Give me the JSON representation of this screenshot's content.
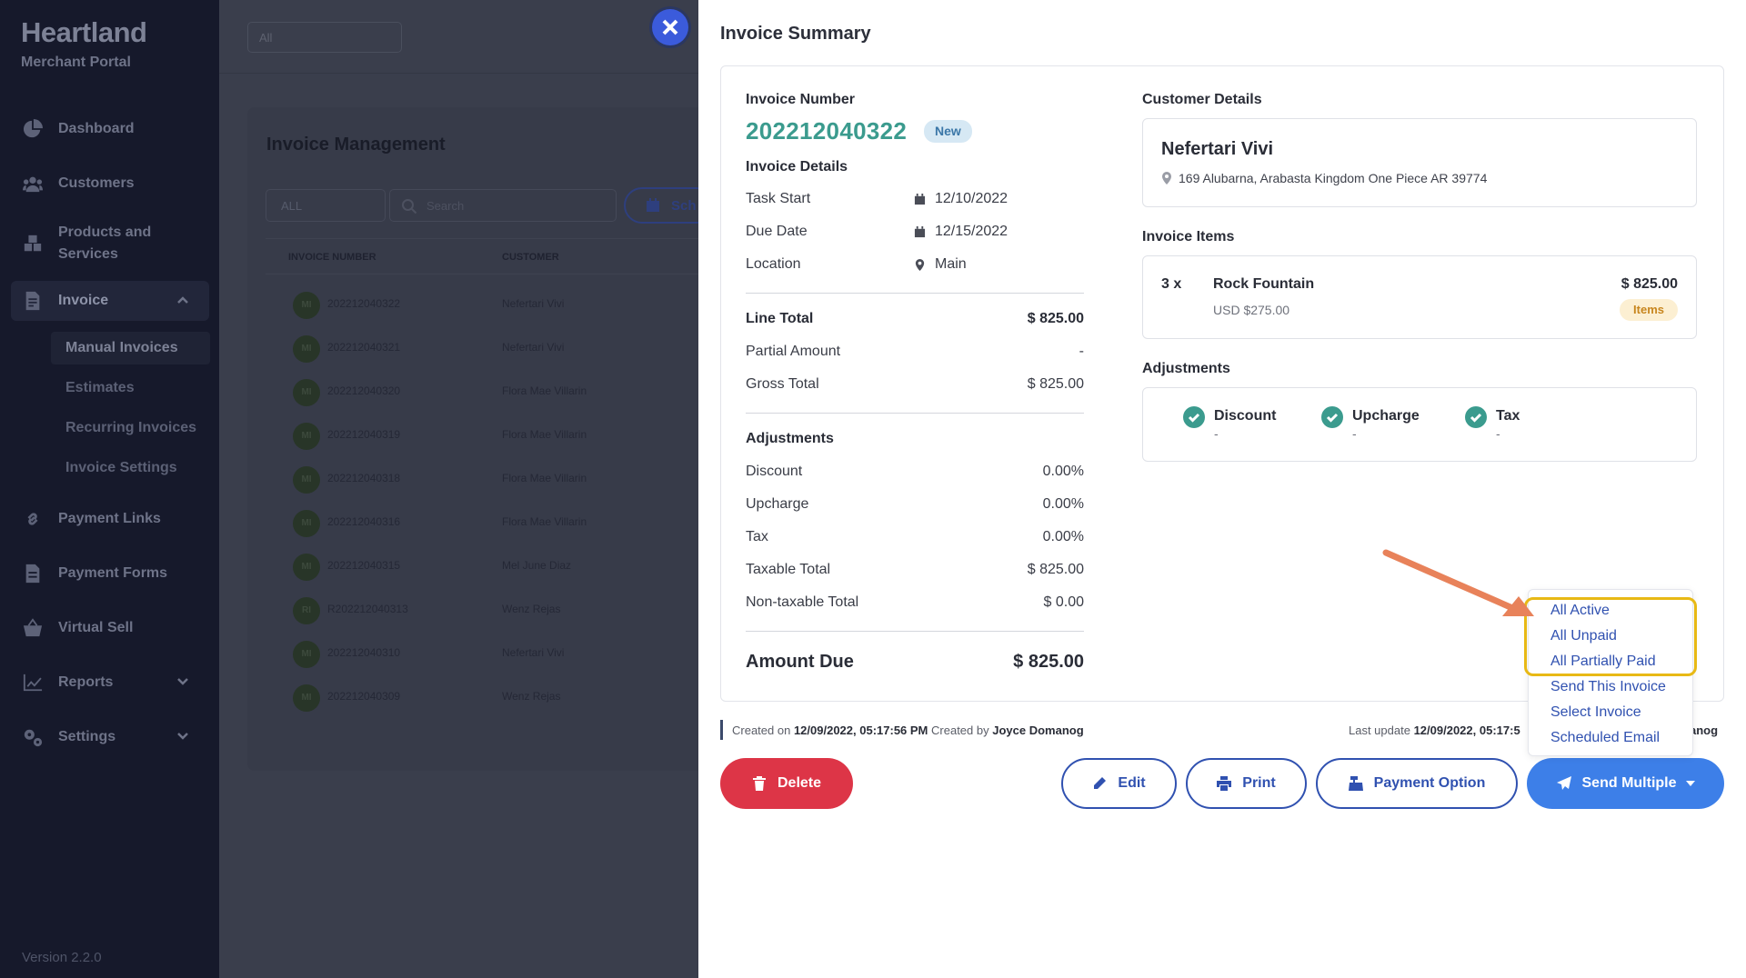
{
  "sidebar": {
    "brand": "Heartland",
    "brand_sub": "Merchant Portal",
    "items": [
      {
        "label": "Dashboard"
      },
      {
        "label": "Customers"
      },
      {
        "label": "Products and Services"
      },
      {
        "label": "Invoice"
      },
      {
        "label": "Payment Links"
      },
      {
        "label": "Payment Forms"
      },
      {
        "label": "Virtual Sell"
      },
      {
        "label": "Reports"
      },
      {
        "label": "Settings"
      }
    ],
    "invoice_sub": [
      {
        "label": "Manual Invoices"
      },
      {
        "label": "Estimates"
      },
      {
        "label": "Recurring Invoices"
      },
      {
        "label": "Invoice Settings"
      }
    ],
    "version": "Version 2.2.0"
  },
  "background": {
    "filter_value": "All",
    "title": "Invoice Management",
    "status_filter": "ALL",
    "search_placeholder": "Search",
    "schedule_label": "Sch",
    "col_invoice": "INVOICE NUMBER",
    "col_customer": "CUSTOMER",
    "rows": [
      {
        "initials": "MI",
        "number": "202212040322",
        "customer": "Nefertari Vivi"
      },
      {
        "initials": "MI",
        "number": "202212040321",
        "customer": "Nefertari Vivi"
      },
      {
        "initials": "MI",
        "number": "202212040320",
        "customer": "Flora Mae Villarin"
      },
      {
        "initials": "MI",
        "number": "202212040319",
        "customer": "Flora Mae Villarin"
      },
      {
        "initials": "MI",
        "number": "202212040318",
        "customer": "Flora Mae Villarin"
      },
      {
        "initials": "MI",
        "number": "202212040316",
        "customer": "Flora Mae Villarin"
      },
      {
        "initials": "MI",
        "number": "202212040315",
        "customer": "Mel June Diaz"
      },
      {
        "initials": "RI",
        "number": "R202212040313",
        "customer": "Wenz Rejas"
      },
      {
        "initials": "MI",
        "number": "202212040310",
        "customer": "Nefertari Vivi"
      },
      {
        "initials": "MI",
        "number": "202212040309",
        "customer": "Wenz Rejas"
      }
    ]
  },
  "modal": {
    "title": "Invoice Summary",
    "invoice_number_label": "Invoice Number",
    "invoice_number": "202212040322",
    "status_badge": "New",
    "details_label": "Invoice Details",
    "task_start_label": "Task Start",
    "task_start": "12/10/2022",
    "due_date_label": "Due Date",
    "due_date": "12/15/2022",
    "location_label": "Location",
    "location": "Main",
    "line_total_label": "Line Total",
    "line_total": "$ 825.00",
    "partial_label": "Partial Amount",
    "partial": "-",
    "gross_label": "Gross Total",
    "gross": "$ 825.00",
    "adjustments_label": "Adjustments",
    "discount_label": "Discount",
    "discount": "0.00%",
    "upcharge_label": "Upcharge",
    "upcharge": "0.00%",
    "tax_label": "Tax",
    "tax": "0.00%",
    "taxable_label": "Taxable Total",
    "taxable": "$ 825.00",
    "nontaxable_label": "Non-taxable Total",
    "nontaxable": "$ 0.00",
    "amount_due_label": "Amount Due",
    "amount_due": "$ 825.00",
    "customer_details_label": "Customer Details",
    "customer_name": "Nefertari Vivi",
    "customer_address": "169 Alubarna, Arabasta Kingdom One Piece AR 39774",
    "items_label": "Invoice Items",
    "item": {
      "qty": "3 x",
      "name": "Rock Fountain",
      "unit": "USD $275.00",
      "price": "$ 825.00",
      "badge": "Items"
    },
    "adj_right_label": "Adjustments",
    "adj_right": [
      {
        "label": "Discount",
        "value": "-"
      },
      {
        "label": "Upcharge",
        "value": "-"
      },
      {
        "label": "Tax",
        "value": "-"
      }
    ],
    "created_prefix": "Created on",
    "created_on": "12/09/2022, 05:17:56 PM",
    "created_by_prefix": "Created by",
    "created_by": "Joyce Domanog",
    "last_update_prefix": "Last update",
    "last_update": "12/09/2022, 05:17:5",
    "last_update_tail": "anog",
    "buttons": {
      "delete": "Delete",
      "edit": "Edit",
      "print": "Print",
      "payment_option": "Payment Option",
      "send_multiple": "Send Multiple"
    },
    "send_menu": [
      "All Active",
      "All Unpaid",
      "All Partially Paid",
      "Send This Invoice",
      "Select Invoice",
      "Scheduled Email"
    ]
  },
  "colors": {
    "accent": "#3d7fe8",
    "teal": "#3b9b8e",
    "danger": "#dd3547",
    "highlight": "#e8b915",
    "arrow": "#e8825a"
  }
}
